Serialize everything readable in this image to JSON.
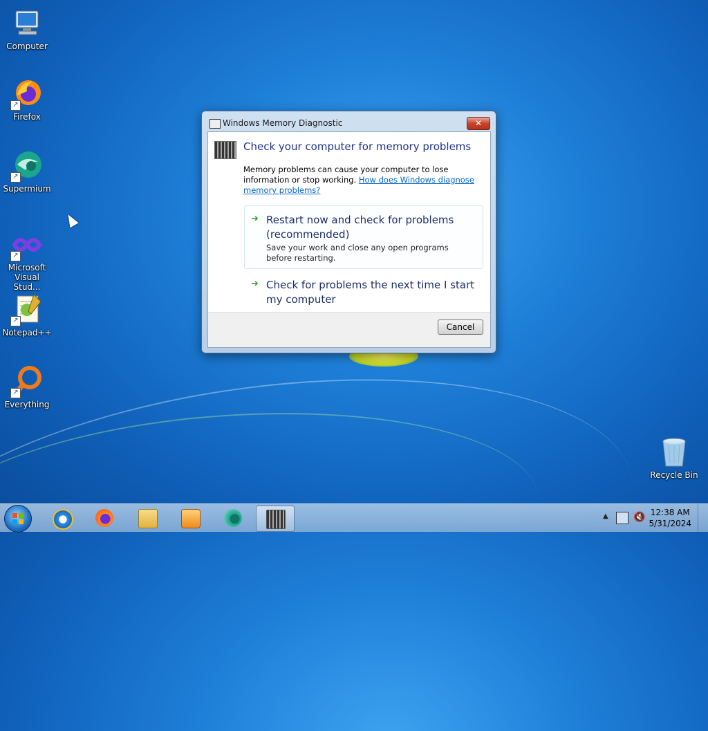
{
  "desktop": {
    "icons": [
      {
        "label": "Computer"
      },
      {
        "label": "Firefox"
      },
      {
        "label": "Supermium"
      },
      {
        "label": "Microsoft Visual Stud..."
      },
      {
        "label": "Notepad++"
      },
      {
        "label": "Everything"
      },
      {
        "label": "Recycle Bin"
      }
    ]
  },
  "dialog": {
    "title": "Windows Memory Diagnostic",
    "close_label": "✕",
    "heading": "Check your computer for memory problems",
    "description": "Memory problems can cause your computer to lose information or stop working.",
    "help_link": "How does Windows diagnose memory problems?",
    "option1": {
      "main": "Restart now and check for problems (recommended)",
      "sub": "Save your work and close any open programs before restarting."
    },
    "option2": {
      "main": "Check for problems the next time I start my computer"
    },
    "cancel_label": "Cancel"
  },
  "taskbar": {
    "items": [
      {
        "icon": "internet-explorer-icon"
      },
      {
        "icon": "firefox-icon"
      },
      {
        "icon": "file-explorer-icon"
      },
      {
        "icon": "media-player-icon"
      },
      {
        "icon": "supermium-icon"
      },
      {
        "icon": "memory-diagnostic-icon",
        "active": true
      }
    ],
    "clock_time": "12:38 AM",
    "clock_date": "5/31/2024"
  },
  "colors": {
    "heading": "#1e3287",
    "link": "#0066cc",
    "arrow": "#2fa62f",
    "close": "#c8442c"
  }
}
